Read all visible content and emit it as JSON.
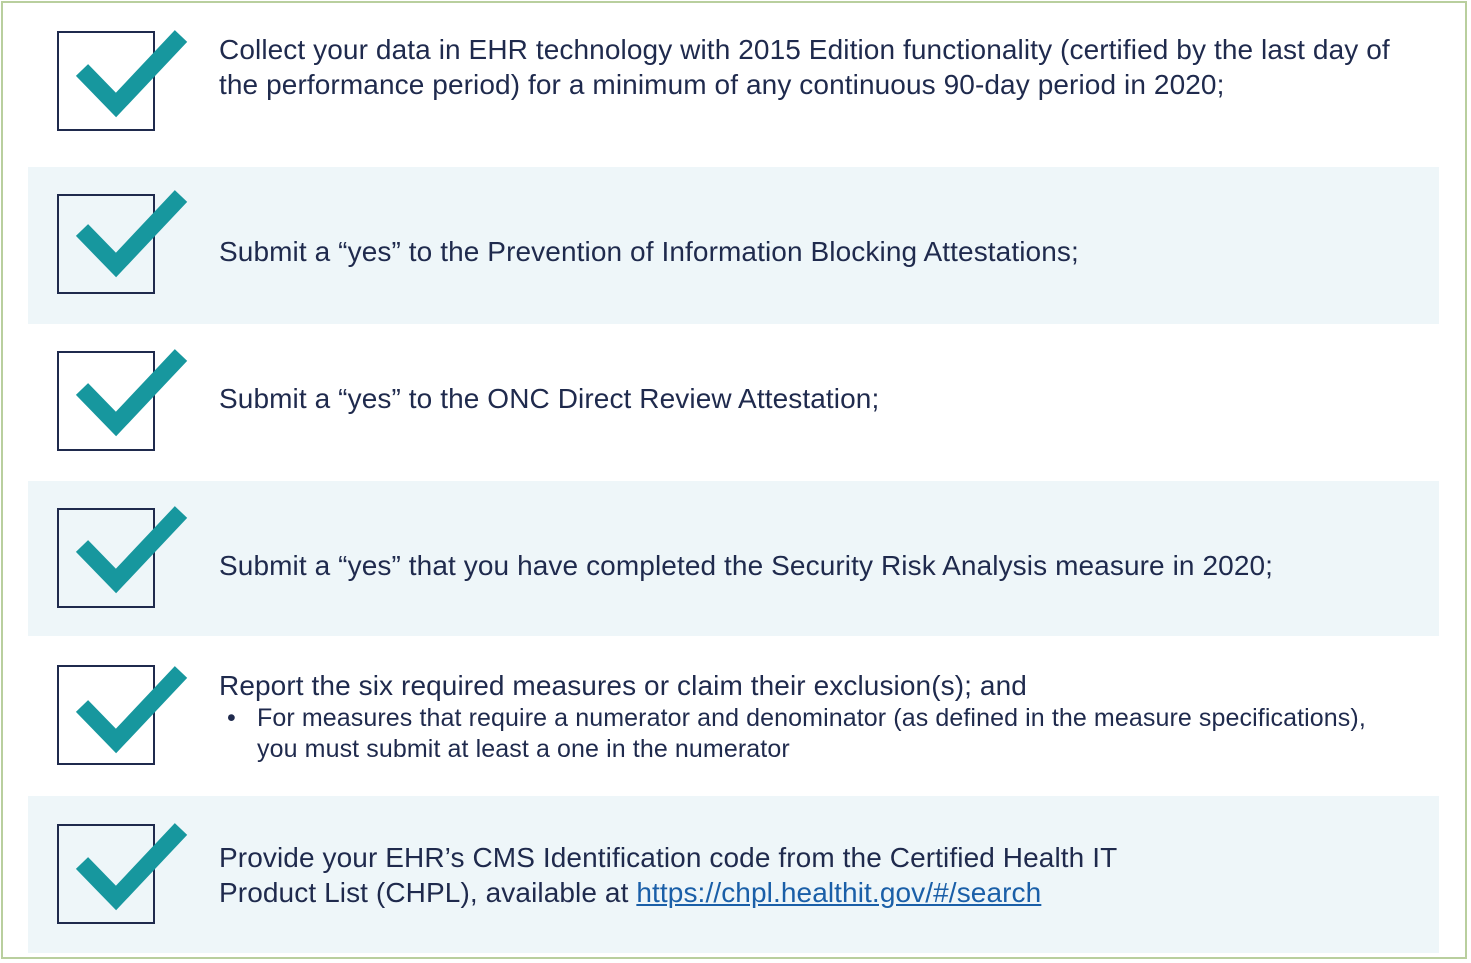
{
  "colors": {
    "frame_border": "#b9cf9e",
    "row_shade": "#eef6f9",
    "checkmark": "#17979e",
    "checkbox_border": "#1f2a4d",
    "text": "#1f2a4d",
    "link": "#1a5fa8"
  },
  "checklist": [
    {
      "id": "cehrt",
      "checked": true,
      "text": "Collect your data in EHR technology with 2015 Edition functionality (certified by the last day of the performance period) for a minimum of any continuous 90-day period in 2020;"
    },
    {
      "id": "info-blocking",
      "checked": true,
      "text": "Submit a “yes” to the Prevention of Information Blocking Attestations;"
    },
    {
      "id": "onc-review",
      "checked": true,
      "text": "Submit a “yes” to the ONC Direct Review Attestation;"
    },
    {
      "id": "security-risk",
      "checked": true,
      "text": "Submit a “yes” that you have completed the Security Risk Analysis measure in 2020;"
    },
    {
      "id": "six-measures",
      "checked": true,
      "text": "Report the six required measures or claim their exclusion(s); and",
      "bullets": [
        "For measures that require a numerator and denominator (as defined in the measure specifications), you must submit at least a one in the numerator"
      ]
    },
    {
      "id": "chpl",
      "checked": true,
      "text": "Provide your EHR’s CMS Identification code from the Certified Health IT Product List (CHPL), available at ",
      "link_text": "https://chpl.healthit.gov/#/search"
    }
  ]
}
